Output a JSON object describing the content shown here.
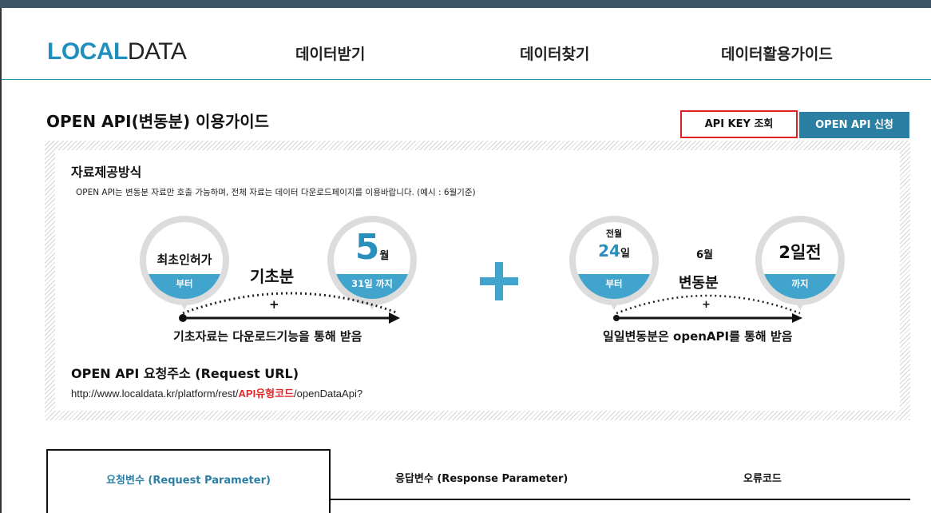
{
  "header": {
    "logo_part1": "LOCAL",
    "logo_part2": "DATA",
    "nav": [
      "데이터받기",
      "데이터찾기",
      "데이터활용가이드"
    ]
  },
  "page": {
    "title": "OPEN API(변동분) 이용가이드",
    "api_key_button": "API KEY 조회",
    "apply_button": "OPEN API 신청"
  },
  "provision": {
    "title": "자료제공방식",
    "description": "OPEN API는 변동분 자료만 호출 가능하며, 전체 자료는 데이터 다운로드페이지를 이용바랍니다. (예시 : 6월기준)",
    "left_flow": {
      "badge1_text": "최초인허가",
      "badge1_band": "부터",
      "badge2_number": "5",
      "badge2_unit": "월",
      "badge2_band": "31일 까지",
      "label": "기초분",
      "plus": "+",
      "caption": "기초자료는 다운로드기능을 통해 받음"
    },
    "right_flow": {
      "badge1_top": "전월",
      "badge1_number": "24",
      "badge1_unit": "일",
      "badge1_band": "부터",
      "month": "6월",
      "badge2_text": "2일전",
      "badge2_band": "까지",
      "label": "변동분",
      "plus": "+",
      "caption": "일일변동분은 openAPI를 통해 받음"
    },
    "url_title": "OPEN API 요청주소 (Request URL)",
    "url_prefix": "http://www.localdata.kr/platform/rest/",
    "url_highlight": "API유형코드",
    "url_suffix": "/openDataApi?"
  },
  "tabs": [
    "요청변수 (Request Parameter)",
    "응답변수 (Response Parameter)",
    "오류코드"
  ],
  "colors": {
    "accent": "#2b8fbd",
    "badge_band": "#41a4cc",
    "apply_button": "#2b7fa3",
    "highlight_red": "#e02828"
  }
}
